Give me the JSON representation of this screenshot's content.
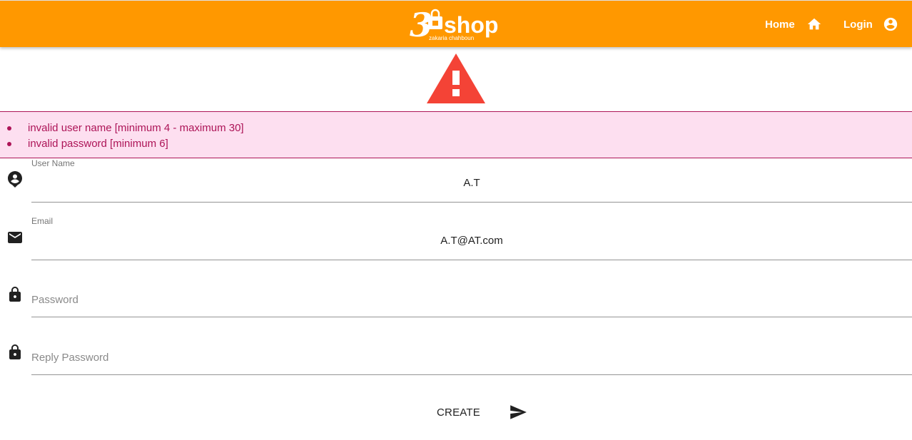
{
  "header": {
    "logo_text": "shop",
    "logo_prefix": "3",
    "logo_subtext": "zakaria chahboun",
    "nav": {
      "home_label": "Home",
      "login_label": "Login"
    },
    "background_color": "#ff9800"
  },
  "alert": {
    "icon": "warning-icon",
    "color": "#f44336"
  },
  "errors": [
    "invalid user name [minimum 4 - maximum 30]",
    "invalid password [minimum 6]"
  ],
  "form": {
    "username": {
      "label": "User Name",
      "value": "A.T",
      "icon": "account-circle-icon"
    },
    "email": {
      "label": "Email",
      "value": "A.T@AT.com",
      "icon": "mail-icon"
    },
    "password": {
      "placeholder": "Password",
      "icon": "lock-icon"
    },
    "reply_password": {
      "placeholder": "Reply Password",
      "icon": "lock-icon"
    },
    "submit_label": "CREATE"
  }
}
